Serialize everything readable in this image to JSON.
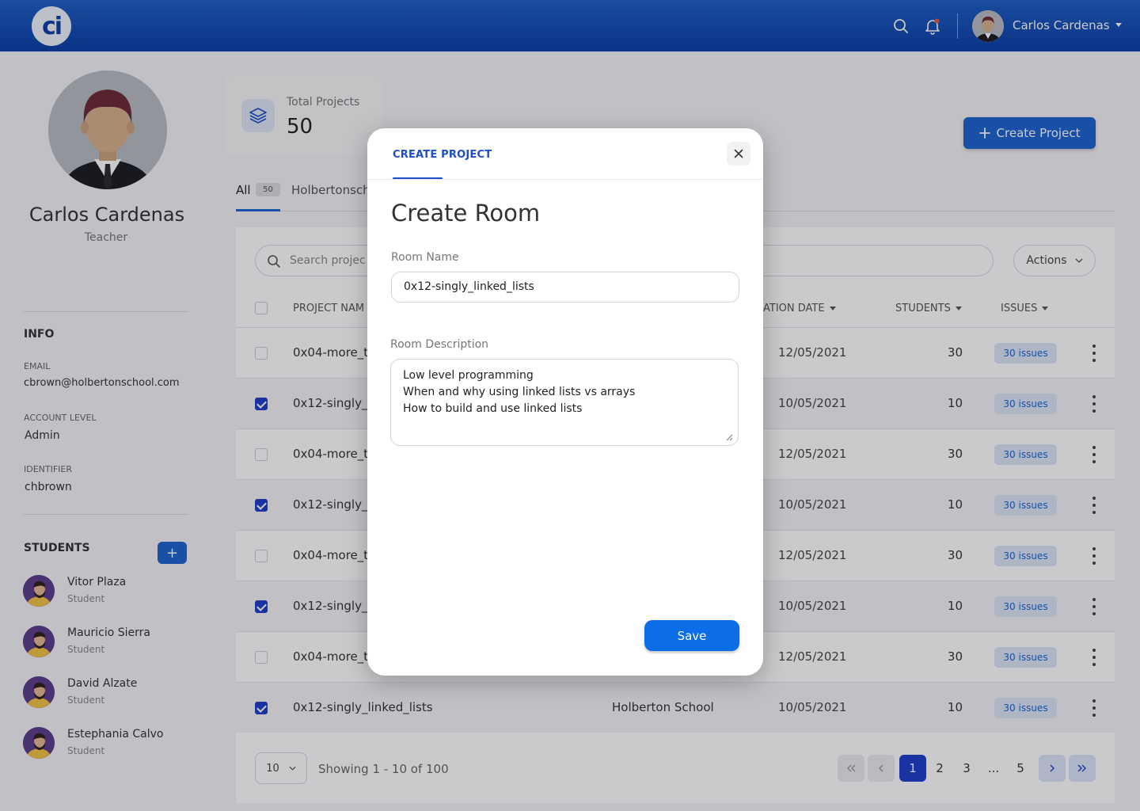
{
  "header": {
    "logo_text": "ci",
    "user_name": "Carlos Cardenas",
    "accent": "#0b3ea6"
  },
  "profile": {
    "name": "Carlos Cardenas",
    "role": "Teacher",
    "info_title": "INFO",
    "email_label": "EMAIL",
    "email": "cbrown@holbertonschool.com",
    "account_label": "ACCOUNT LEVEL",
    "account_level": "Admin",
    "identifier_label": "IDENTIFIER",
    "identifier": "chbrown",
    "students_title": "STUDENTS",
    "add_label": "+",
    "students": [
      {
        "name": "Vitor Plaza",
        "role": "Student"
      },
      {
        "name": "Mauricio Sierra",
        "role": "Student"
      },
      {
        "name": "David Alzate",
        "role": "Student"
      },
      {
        "name": "Estephania Calvo",
        "role": "Student"
      }
    ]
  },
  "main": {
    "total_label": "Total Projects",
    "total_value": "50",
    "create_label": "Create Project",
    "tabs": [
      {
        "label": "All",
        "badge": "50"
      },
      {
        "label": "Holbertonsch"
      }
    ],
    "search_placeholder": "Search projec",
    "actions_label": "Actions",
    "columns": {
      "project": "PROJECT NAM",
      "date": "ATION DATE",
      "students": "STUDENTS",
      "issues": "ISSUES"
    },
    "rows": [
      {
        "name": "0x04-more_t",
        "org": "",
        "date": "12/05/2021",
        "students": "30",
        "issues": "30 issues",
        "checked": false
      },
      {
        "name": "0x12-singly_l",
        "org": "",
        "date": "10/05/2021",
        "students": "10",
        "issues": "30 issues",
        "checked": true
      },
      {
        "name": "0x04-more_t",
        "org": "",
        "date": "12/05/2021",
        "students": "30",
        "issues": "30 issues",
        "checked": false
      },
      {
        "name": "0x12-singly_l",
        "org": "",
        "date": "10/05/2021",
        "students": "10",
        "issues": "30 issues",
        "checked": true
      },
      {
        "name": "0x04-more_t",
        "org": "",
        "date": "12/05/2021",
        "students": "30",
        "issues": "30 issues",
        "checked": false
      },
      {
        "name": "0x12-singly_l",
        "org": "",
        "date": "10/05/2021",
        "students": "10",
        "issues": "30 issues",
        "checked": true
      },
      {
        "name": "0x04-more_t",
        "org": "",
        "date": "12/05/2021",
        "students": "30",
        "issues": "30 issues",
        "checked": false
      },
      {
        "name": "0x12-singly_linked_lists",
        "org": "Holberton School",
        "date": "10/05/2021",
        "students": "10",
        "issues": "30 issues",
        "checked": true
      }
    ],
    "per_page": "10",
    "showing": "Showing 1 - 10 of 100",
    "pages": [
      "1",
      "2",
      "3",
      "...",
      "5"
    ]
  },
  "modal": {
    "tab_label": "CREATE PROJECT",
    "title": "Create Room",
    "room_name_label": "Room Name",
    "room_name_value": "0x12-singly_linked_lists",
    "room_desc_label": "Room Description",
    "room_desc_lines": [
      "Low level programming",
      "When and why using linked lists vs arrays",
      "How to build and use linked lists"
    ],
    "save_label": "Save"
  }
}
